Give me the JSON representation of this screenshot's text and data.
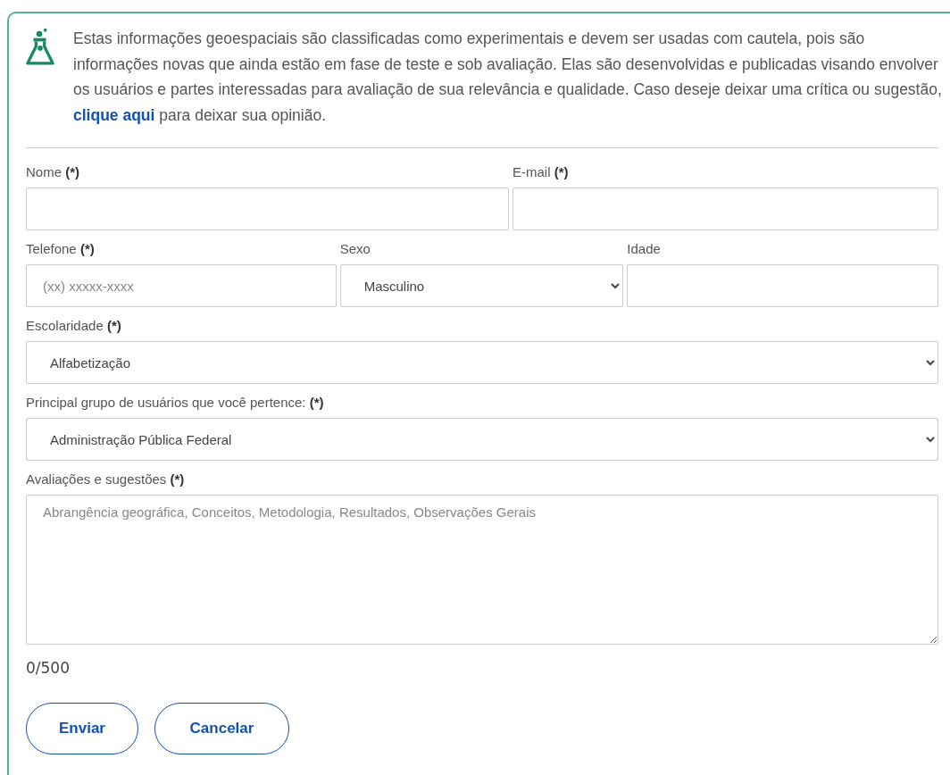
{
  "notice": {
    "before": "Estas informações geoespaciais são classificadas como experimentais e devem ser usadas com cautela, pois são informações novas que ainda estão em fase de teste e sob avaliação. Elas são desenvolvidas e publicadas visando envolver os usuários e partes interessadas para avaliação de sua relevância e qualidade. Caso deseje deixar uma crítica ou sugestão,",
    "link": "clique aqui",
    "after": "para deixar sua opinião."
  },
  "form": {
    "rows": [
      [
        {
          "label": "Nome **(*)**",
          "kind": "input"
        },
        {
          "label": "E-mail **(*)**",
          "kind": "input"
        }
      ],
      [
        {
          "label": "Telefone **(*)**",
          "kind": "input",
          "placeholder": "(xx) xxxxx-xxxx"
        },
        {
          "label": "Sexo",
          "kind": "select",
          "value": "Masculino"
        },
        {
          "label": "Idade",
          "kind": "input"
        }
      ],
      [
        {
          "label": "Escolaridade **(*)**",
          "kind": "select",
          "value": "Alfabetização"
        }
      ],
      [
        {
          "label": "Principal grupo de usuários que você pertence: **(*)**",
          "kind": "select",
          "value": "Administração Pública Federal"
        }
      ],
      [
        {
          "label": "Avaliações e sugestões **(*)**",
          "kind": "textarea",
          "placeholder": "Abrangência geográfica, Conceitos, Metodologia, Resultados, Observações Gerais"
        }
      ]
    ],
    "counter": "0/500",
    "buttons": [
      "Enviar",
      "Cancelar"
    ]
  }
}
